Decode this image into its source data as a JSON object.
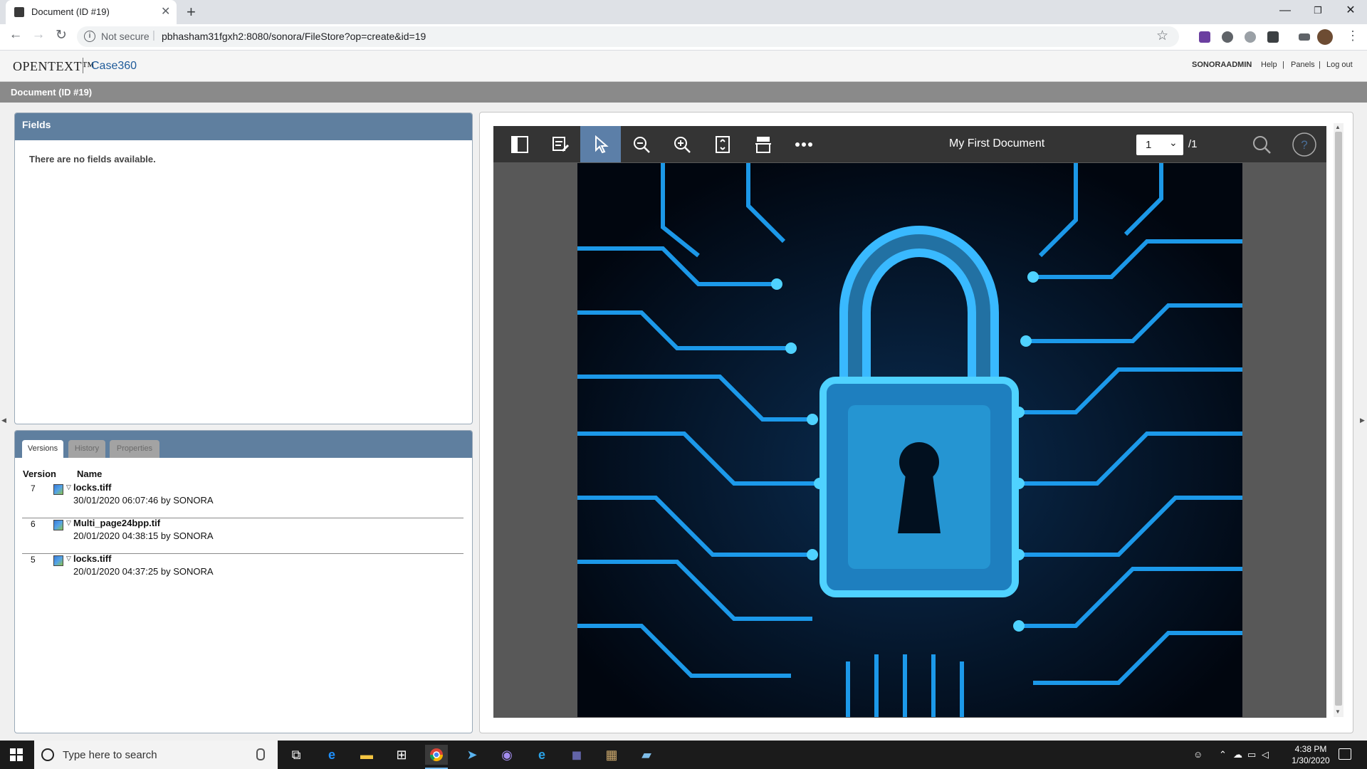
{
  "browser": {
    "tab_title": "Document (ID #19)",
    "security_label": "Not secure",
    "url": "pbhasham31fgxh2:8080/sonora/FileStore?op=create&id=19"
  },
  "app": {
    "vendor": "OpenText™",
    "product": "Case360",
    "user": "SONORAADMIN",
    "links": [
      "Help",
      "Panels",
      "Log out"
    ],
    "separator": "|",
    "page_title": "Document (ID #19)"
  },
  "fields": {
    "title": "Fields",
    "empty_message": "There are no fields available."
  },
  "versions": {
    "tabs": [
      "Versions",
      "History",
      "Properties"
    ],
    "active_tab": "Versions",
    "columns": [
      "Version",
      "Name"
    ],
    "rows": [
      {
        "version": "7",
        "name": "locks.tiff",
        "meta": "30/01/2020 06:07:46 by SONORA"
      },
      {
        "version": "6",
        "name": "Multi_page24bpp.tif",
        "meta": "20/01/2020 04:38:15 by SONORA"
      },
      {
        "version": "5",
        "name": "locks.tiff",
        "meta": "20/01/2020 04:37:25 by SONORA"
      }
    ]
  },
  "viewer": {
    "document_title": "My First Document",
    "page_current": "1",
    "page_total": "/1",
    "tools": [
      "sidebar-toggle",
      "annotate",
      "select-pointer",
      "zoom-out",
      "zoom-in",
      "fit-page",
      "page-layout",
      "more"
    ],
    "active_tool": "select-pointer",
    "image_description_colors": {
      "background": "#020816",
      "circuit": "#1fa8ff",
      "lock": "#4fd2ff"
    }
  },
  "taskbar": {
    "search_placeholder": "Type here to search",
    "time": "4:38 PM",
    "date": "1/30/2020"
  },
  "colors": {
    "panel_header": "#5f7f9f",
    "title_bar": "#8a8a8a",
    "viewer_toolbar": "#343434",
    "active_tool": "#5c7fa8",
    "product_link": "#1e5a99"
  }
}
